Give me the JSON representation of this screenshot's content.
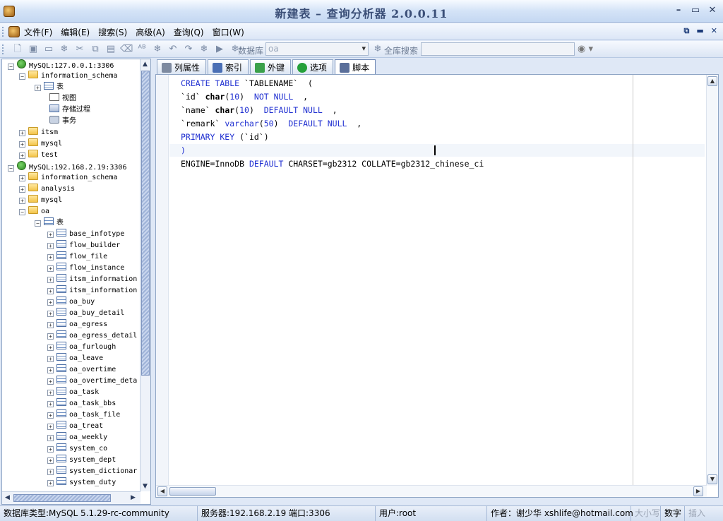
{
  "window": {
    "title": "新建表 – 查询分析器 2.0.0.11"
  },
  "menu": {
    "items": [
      "文件(F)",
      "编辑(E)",
      "搜索(S)",
      "高级(A)",
      "查询(Q)",
      "窗口(W)"
    ]
  },
  "toolbar": {
    "database_label": "数据库",
    "database_value": "oa",
    "fulltext_label": "全库搜索",
    "fulltext_value": ""
  },
  "tree": {
    "rows": [
      {
        "text": "MySQL:127.0.0.1:3306",
        "exp": "−",
        "icon": "server"
      },
      {
        "text": "information_schema",
        "exp": "−",
        "icon": "folder"
      },
      {
        "text": "表",
        "exp": "+",
        "icon": "table"
      },
      {
        "text": "视图",
        "exp": "",
        "icon": "view"
      },
      {
        "text": "存储过程",
        "exp": "",
        "icon": "proc"
      },
      {
        "text": "事务",
        "exp": "",
        "icon": "event"
      },
      {
        "text": "itsm",
        "exp": "+",
        "icon": "folder"
      },
      {
        "text": "mysql",
        "exp": "+",
        "icon": "folder"
      },
      {
        "text": "test",
        "exp": "+",
        "icon": "folder"
      },
      {
        "text": "MySQL:192.168.2.19:3306",
        "exp": "−",
        "icon": "server"
      },
      {
        "text": "information_schema",
        "exp": "+",
        "icon": "folder"
      },
      {
        "text": "analysis",
        "exp": "+",
        "icon": "folder"
      },
      {
        "text": "mysql",
        "exp": "+",
        "icon": "folder"
      },
      {
        "text": "oa",
        "exp": "−",
        "icon": "folder"
      },
      {
        "text": "表",
        "exp": "−",
        "icon": "table"
      },
      {
        "text": "base_infotype",
        "exp": "+",
        "icon": "table"
      },
      {
        "text": "flow_builder",
        "exp": "+",
        "icon": "table"
      },
      {
        "text": "flow_file",
        "exp": "+",
        "icon": "table"
      },
      {
        "text": "flow_instance",
        "exp": "+",
        "icon": "table"
      },
      {
        "text": "itsm_information",
        "exp": "+",
        "icon": "table"
      },
      {
        "text": "itsm_information",
        "exp": "+",
        "icon": "table"
      },
      {
        "text": "oa_buy",
        "exp": "+",
        "icon": "table"
      },
      {
        "text": "oa_buy_detail",
        "exp": "+",
        "icon": "table"
      },
      {
        "text": "oa_egress",
        "exp": "+",
        "icon": "table"
      },
      {
        "text": "oa_egress_detail",
        "exp": "+",
        "icon": "table"
      },
      {
        "text": "oa_furlough",
        "exp": "+",
        "icon": "table"
      },
      {
        "text": "oa_leave",
        "exp": "+",
        "icon": "table"
      },
      {
        "text": "oa_overtime",
        "exp": "+",
        "icon": "table"
      },
      {
        "text": "oa_overtime_deta",
        "exp": "+",
        "icon": "table"
      },
      {
        "text": "oa_task",
        "exp": "+",
        "icon": "table"
      },
      {
        "text": "oa_task_bbs",
        "exp": "+",
        "icon": "table"
      },
      {
        "text": "oa_task_file",
        "exp": "+",
        "icon": "table"
      },
      {
        "text": "oa_treat",
        "exp": "+",
        "icon": "table"
      },
      {
        "text": "oa_weekly",
        "exp": "+",
        "icon": "table"
      },
      {
        "text": "system_co",
        "exp": "+",
        "icon": "table"
      },
      {
        "text": "system_dept",
        "exp": "+",
        "icon": "table"
      },
      {
        "text": "system_dictionar",
        "exp": "+",
        "icon": "table"
      },
      {
        "text": "system_duty",
        "exp": "+",
        "icon": "table"
      }
    ]
  },
  "tabs": [
    {
      "label": "列属性",
      "icon": "wrench-icon"
    },
    {
      "label": "索引",
      "icon": "index-icon"
    },
    {
      "label": "外键",
      "icon": "key-icon"
    },
    {
      "label": "选项",
      "icon": "check-icon"
    },
    {
      "label": "脚本",
      "icon": "script-icon",
      "active": true
    }
  ],
  "editor": {
    "lines": [
      [
        [
          "kw",
          "CREATE TABLE"
        ],
        [
          "t",
          " `TABLENAME`  ("
        ]
      ],
      [
        [
          "t",
          "`id` "
        ],
        [
          "kwb",
          "char"
        ],
        [
          "t",
          "("
        ],
        [
          "num",
          "10"
        ],
        [
          "t",
          ")  "
        ],
        [
          "kw",
          "NOT NULL"
        ],
        [
          "t",
          "  ,"
        ]
      ],
      [
        [
          "t",
          "`name` "
        ],
        [
          "kwb",
          "char"
        ],
        [
          "t",
          "("
        ],
        [
          "num",
          "10"
        ],
        [
          "t",
          ")  "
        ],
        [
          "kw",
          "DEFAULT NULL"
        ],
        [
          "t",
          "  ,"
        ]
      ],
      [
        [
          "t",
          "`remark` "
        ],
        [
          "kw",
          "varchar"
        ],
        [
          "t",
          "("
        ],
        [
          "num",
          "50"
        ],
        [
          "t",
          ")  "
        ],
        [
          "kw",
          "DEFAULT NULL"
        ],
        [
          "t",
          "  ,"
        ]
      ],
      [
        [
          "kw",
          "PRIMARY KEY"
        ],
        [
          "t",
          " (`id`)"
        ]
      ],
      [
        [
          "kw",
          ")"
        ]
      ],
      [
        [
          "t",
          "ENGINE=InnoDB "
        ],
        [
          "kw",
          "DEFAULT"
        ],
        [
          "t",
          " CHARSET=gb2312 COLLATE=gb2312_chinese_ci"
        ]
      ]
    ]
  },
  "status": {
    "db_type": "数据库类型:MySQL 5.1.29-rc-community",
    "server": "服务器:192.168.2.19  端口:3306",
    "user": "用户:root",
    "author": "作者：谢少华  xshlife@hotmail.com",
    "size": "大小写",
    "num": "数字",
    "insert": "插入"
  }
}
